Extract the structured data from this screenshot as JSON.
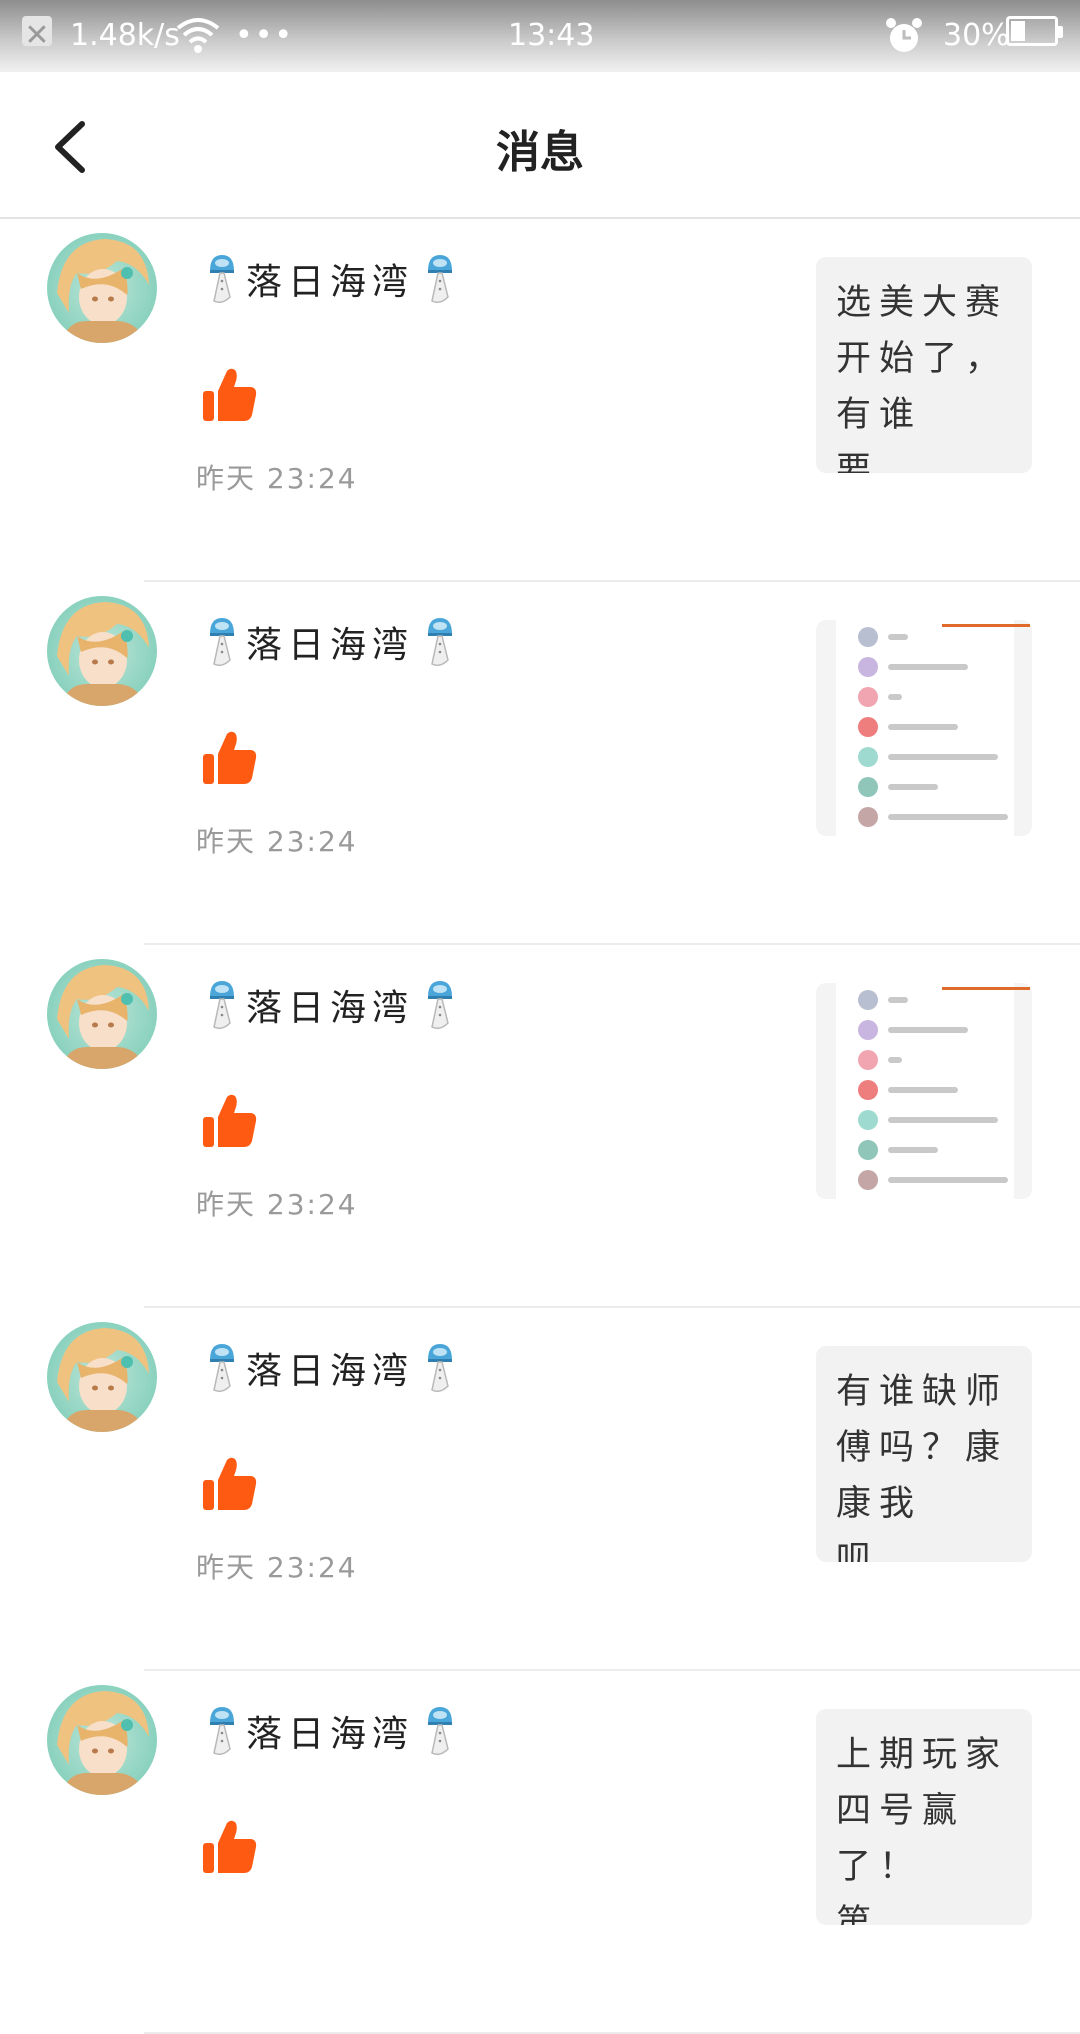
{
  "status_bar": {
    "speed": "1.48k/s",
    "dots": "•••",
    "time": "13:43",
    "battery_percent": "30%",
    "battery_level": 0.3
  },
  "header": {
    "title": "消息"
  },
  "messages": [
    {
      "username": "落日海湾",
      "timestamp": "昨天 23:24",
      "preview_type": "text",
      "preview_text": "选美大赛开始了，有谁要..."
    },
    {
      "username": "落日海湾",
      "timestamp": "昨天 23:24",
      "preview_type": "image"
    },
    {
      "username": "落日海湾",
      "timestamp": "昨天 23:24",
      "preview_type": "image"
    },
    {
      "username": "落日海湾",
      "timestamp": "昨天 23:24",
      "preview_type": "text",
      "preview_text": "有谁缺师傅吗？康康我呗..."
    },
    {
      "username": "落日海湾",
      "timestamp": "",
      "preview_type": "text",
      "preview_text": "上期玩家四号赢了！第..."
    }
  ],
  "colors": {
    "like": "#ff5a12",
    "thumb_accent": "#e06a2a"
  },
  "icons": {
    "back": "chevron-left-icon",
    "like": "thumbs-up-icon",
    "wind_chime": "wind-chime-icon",
    "wifi": "wifi-icon",
    "alarm": "alarm-clock-icon",
    "battery": "battery-icon"
  }
}
